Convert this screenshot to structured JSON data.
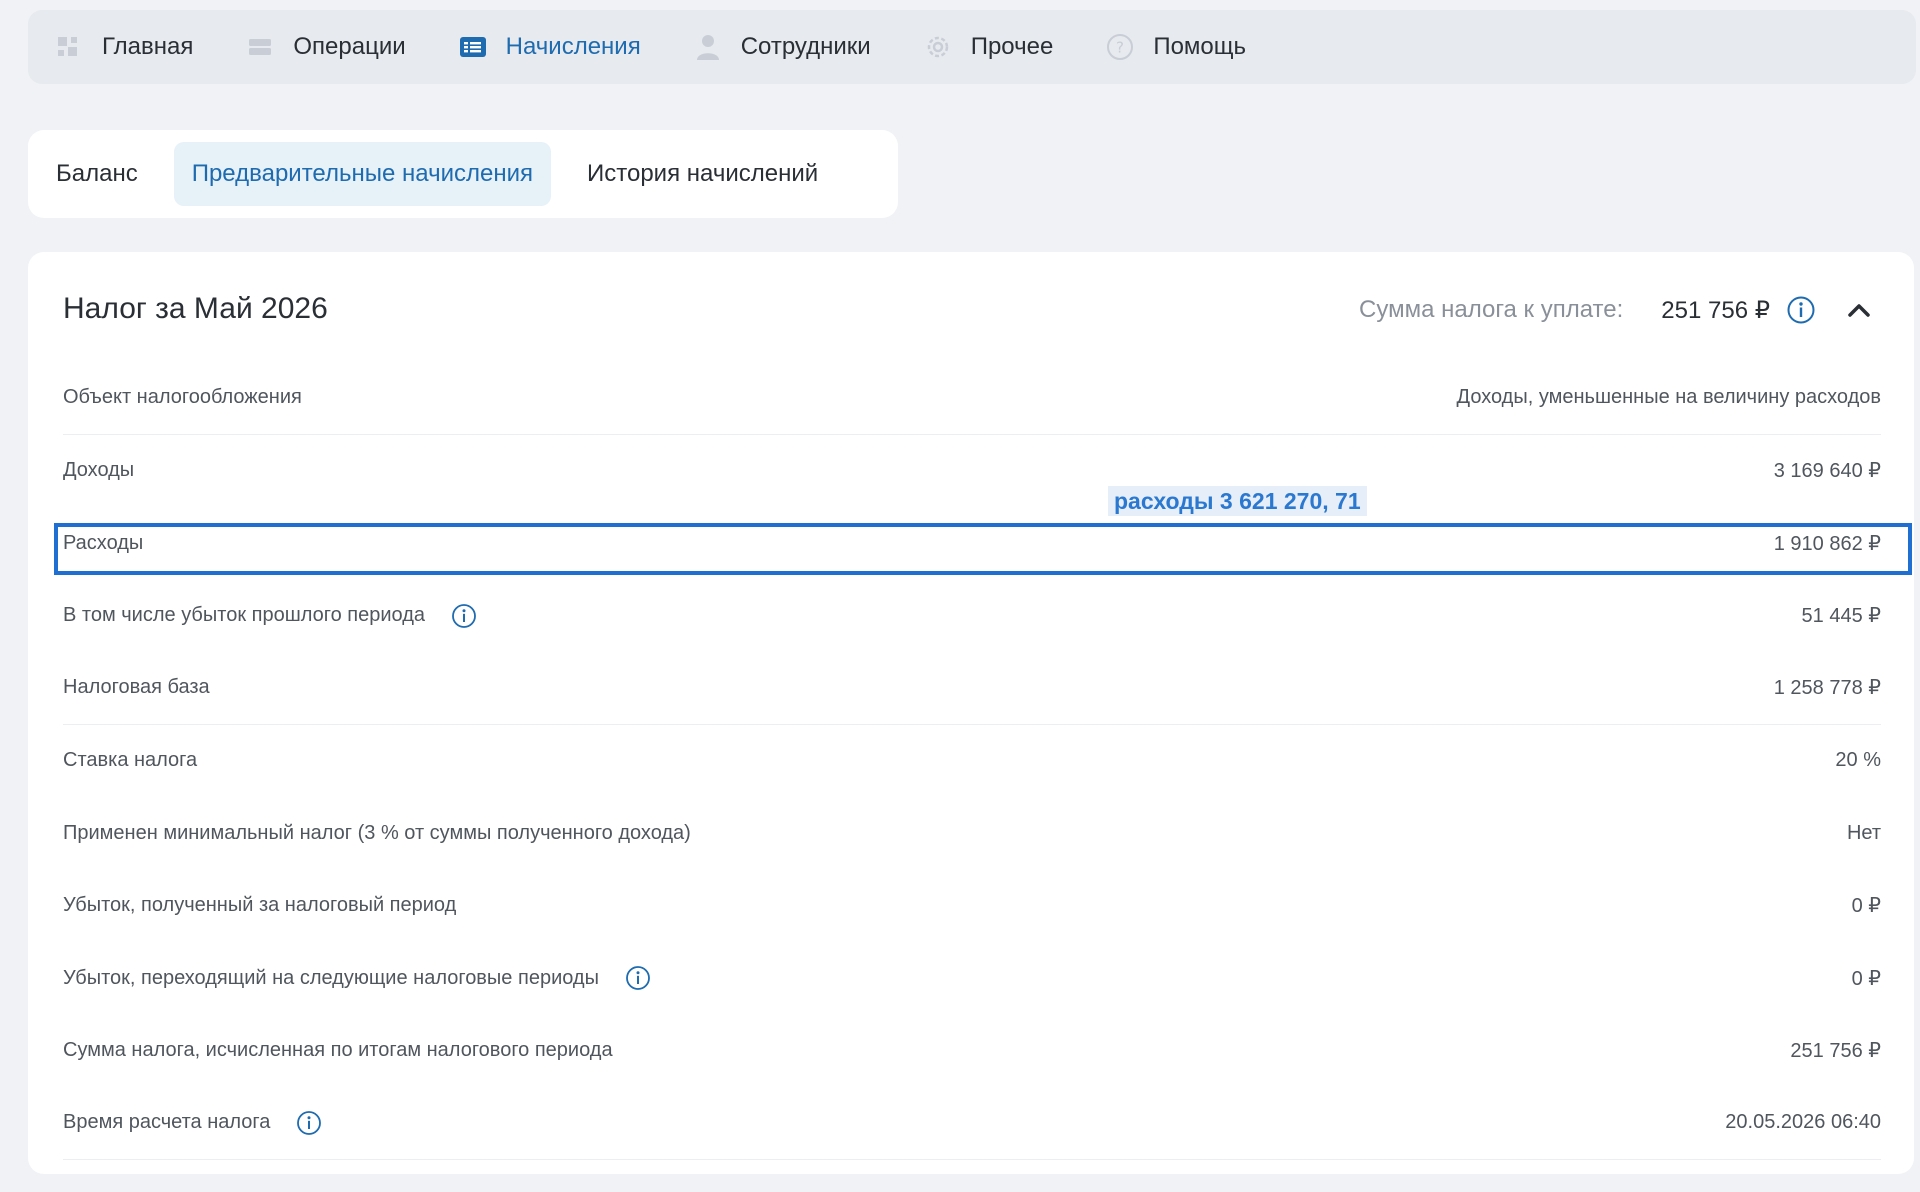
{
  "nav": {
    "items": [
      {
        "label": "Главная",
        "icon": "grid-icon",
        "active": false
      },
      {
        "label": "Операции",
        "icon": "list-icon",
        "active": false
      },
      {
        "label": "Начисления",
        "icon": "accruals-icon",
        "active": true
      },
      {
        "label": "Сотрудники",
        "icon": "person-icon",
        "active": false
      },
      {
        "label": "Прочее",
        "icon": "gear-icon",
        "active": false
      },
      {
        "label": "Помощь",
        "icon": "help-icon",
        "active": false
      }
    ]
  },
  "tabs": [
    {
      "label": "Баланс",
      "active": false
    },
    {
      "label": "Предварительные начисления",
      "active": true
    },
    {
      "label": "История начислений",
      "active": false
    }
  ],
  "card": {
    "title": "Налог за Май 2026",
    "summary_label": "Сумма налога к уплате:",
    "summary_value": "251 756 ₽"
  },
  "rows": [
    {
      "label": "Объект налогообложения",
      "value": "Доходы, уменьшенные на величину расходов",
      "info": false,
      "sep": true
    },
    {
      "label": "Доходы",
      "value": "3 169 640 ₽",
      "info": false,
      "sep": false
    },
    {
      "label": "Расходы",
      "value": "1 910 862 ₽",
      "info": false,
      "sep": false
    },
    {
      "label": "В том числе убыток прошлого периода",
      "value": "51 445 ₽",
      "info": true,
      "sep": false
    },
    {
      "label": "Налоговая база",
      "value": "1 258 778 ₽",
      "info": false,
      "sep": true
    },
    {
      "label": "Ставка налога",
      "value": "20 %",
      "info": false,
      "sep": false
    },
    {
      "label": "Применен минимальный налог (3 % от суммы полученного дохода)",
      "value": "Нет",
      "info": false,
      "sep": false
    },
    {
      "label": "Убыток, полученный за налоговый период",
      "value": "0 ₽",
      "info": false,
      "sep": false
    },
    {
      "label": "Убыток, переходящий на следующие налоговые периоды",
      "value": "0 ₽",
      "info": true,
      "sep": false
    },
    {
      "label": "Сумма налога, исчисленная по итогам налогового периода",
      "value": "251 756 ₽",
      "info": false,
      "sep": false
    },
    {
      "label": "Время расчета налога",
      "value": "20.05.2026 06:40",
      "info": true,
      "sep": true
    }
  ],
  "annotation": {
    "text": "расходы 3 621 270, 71",
    "color": "#1e6fd1"
  },
  "colors": {
    "accent": "#1e6bb0",
    "active_tab_bg": "#e6f1f8"
  }
}
